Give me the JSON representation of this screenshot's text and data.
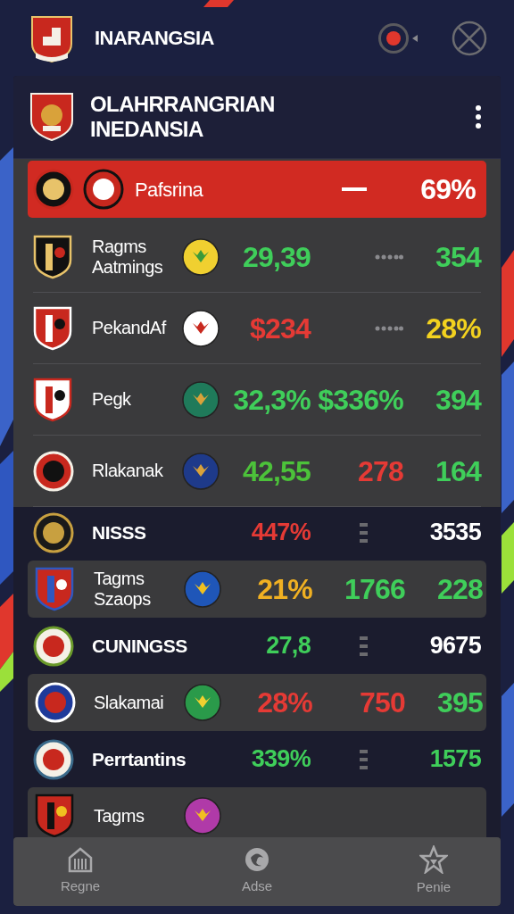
{
  "app_bar": {
    "title": "INARANGSIA"
  },
  "header": {
    "title_lines": [
      "OLAHRRANGRIAN",
      "INEDANSIA"
    ]
  },
  "rows": [
    {
      "kind": "highlight",
      "name": "Pafsrina",
      "second_crest": true,
      "cells": [
        {
          "kind": "dash"
        },
        {
          "kind": "text",
          "text": "69%",
          "color": "#ffffff"
        }
      ]
    },
    {
      "kind": "stat",
      "name": "Ragms Aatmings",
      "second_crest": true,
      "cells": [
        {
          "kind": "text",
          "text": "29,39",
          "color": "#3fce5a"
        },
        {
          "kind": "dots"
        },
        {
          "kind": "text",
          "text": "354",
          "color": "#3fce5a"
        }
      ]
    },
    {
      "kind": "stat",
      "name": "PekandAf",
      "second_crest": true,
      "cells": [
        {
          "kind": "text",
          "text": "$234",
          "color": "#e53a35"
        },
        {
          "kind": "dots"
        },
        {
          "kind": "text",
          "text": "28%",
          "color": "#f3d21f"
        }
      ]
    },
    {
      "kind": "stat",
      "name": "Pegk",
      "second_crest": true,
      "cells": [
        {
          "kind": "text",
          "text": "32,3%",
          "color": "#3fce5a"
        },
        {
          "kind": "text",
          "text": "$336%",
          "color": "#3fce5a"
        },
        {
          "kind": "text",
          "text": "394",
          "color": "#3fce5a"
        }
      ]
    },
    {
      "kind": "stat",
      "name": "Rlakanak",
      "second_crest": true,
      "cells": [
        {
          "kind": "text",
          "text": "42,55",
          "color": "#4cc23a"
        },
        {
          "kind": "text",
          "text": "278",
          "color": "#e53a35"
        },
        {
          "kind": "text",
          "text": "164",
          "color": "#3fce5a"
        }
      ]
    },
    {
      "kind": "plain",
      "name": "NISSS",
      "second_crest": false,
      "cells": [
        {
          "kind": "text",
          "text": "447%",
          "color": "#e53a35"
        },
        {
          "kind": "handle"
        },
        {
          "kind": "text",
          "text": "3535",
          "color": "#ffffff"
        }
      ]
    },
    {
      "kind": "card",
      "name": "Tagms Szaops",
      "second_crest": true,
      "cells": [
        {
          "kind": "text",
          "text": "21%",
          "color": "#f0b022"
        },
        {
          "kind": "text",
          "text": "1766",
          "color": "#3fce5a"
        },
        {
          "kind": "text",
          "text": "228",
          "color": "#3fce5a"
        }
      ]
    },
    {
      "kind": "plain",
      "name": "CUNINGSS",
      "second_crest": false,
      "cells": [
        {
          "kind": "text",
          "text": "27,8",
          "color": "#3fce5a"
        },
        {
          "kind": "handle"
        },
        {
          "kind": "text",
          "text": "9675",
          "color": "#ffffff"
        }
      ]
    },
    {
      "kind": "card",
      "name": "Slakamai",
      "second_crest": true,
      "cells": [
        {
          "kind": "text",
          "text": "28%",
          "color": "#e53a35"
        },
        {
          "kind": "text",
          "text": "750",
          "color": "#e53a35"
        },
        {
          "kind": "text",
          "text": "395",
          "color": "#3fce5a"
        }
      ]
    },
    {
      "kind": "plain",
      "name": "Perrtantins",
      "second_crest": false,
      "cells": [
        {
          "kind": "text",
          "text": "339%",
          "color": "#3fce5a"
        },
        {
          "kind": "handle"
        },
        {
          "kind": "text",
          "text": "1575",
          "color": "#3fce5a"
        }
      ]
    },
    {
      "kind": "card",
      "name": "Tagms",
      "second_crest": true
    }
  ],
  "nav": [
    {
      "label": "Regne",
      "kind": "home"
    },
    {
      "label": "Adse",
      "kind": "badge"
    },
    {
      "label": "Penie",
      "kind": "star"
    }
  ]
}
